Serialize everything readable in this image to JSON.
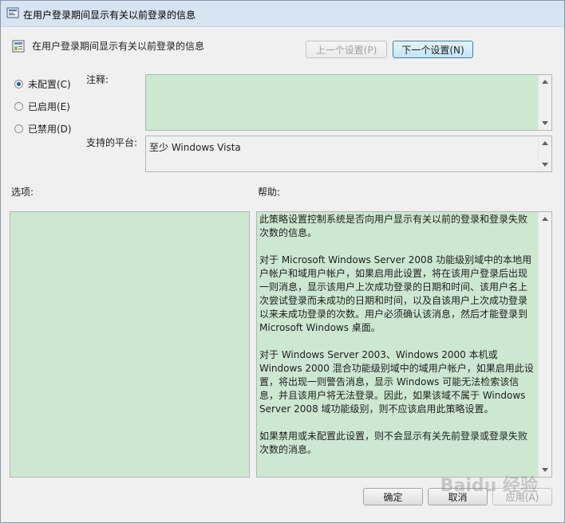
{
  "window": {
    "title": "在用户登录期间显示有关以前登录的信息"
  },
  "header": {
    "title": "在用户登录期间显示有关以前登录的信息",
    "prev_button": "上一个设置(P)",
    "next_button": "下一个设置(N)"
  },
  "state": {
    "options": [
      {
        "label": "未配置(C)",
        "checked": true
      },
      {
        "label": "已启用(E)",
        "checked": false
      },
      {
        "label": "已禁用(D)",
        "checked": false
      }
    ]
  },
  "comment": {
    "label": "注释:",
    "value": ""
  },
  "platform": {
    "label": "支持的平台:",
    "value": "至少 Windows Vista"
  },
  "options_section": {
    "label": "选项:"
  },
  "help": {
    "label": "帮助:",
    "paragraphs": [
      "此策略设置控制系统是否向用户显示有关以前的登录和登录失败次数的信息。",
      "对于 Microsoft Windows Server 2008 功能级别域中的本地用户帐户和域用户帐户，如果启用此设置，将在该用户登录后出现一则消息，显示该用户上次成功登录的日期和时间、该用户名上次尝试登录而未成功的日期和时间，以及自该用户上次成功登录以来未成功登录的次数。用户必须确认该消息，然后才能登录到 Microsoft Windows 桌面。",
      "对于 Windows Server 2003、Windows 2000 本机或 Windows 2000 混合功能级别域中的域用户帐户，如果启用此设置，将出现一则警告消息，显示 Windows 可能无法检索该信息，并且该用户将无法登录。因此，如果该域不属于 Windows Server 2008 域功能级别，则不应该启用此策略设置。",
      "如果禁用或未配置此设置，则不会显示有关先前登录或登录失败次数的消息。"
    ]
  },
  "footer": {
    "ok": "确定",
    "cancel": "取消",
    "apply": "应用(A)"
  },
  "watermark": "Baidu 经验",
  "colors": {
    "field_green": "#cde8d1",
    "title_bar": "#d7e4f2",
    "radio_dot": "#1a5ea8"
  }
}
